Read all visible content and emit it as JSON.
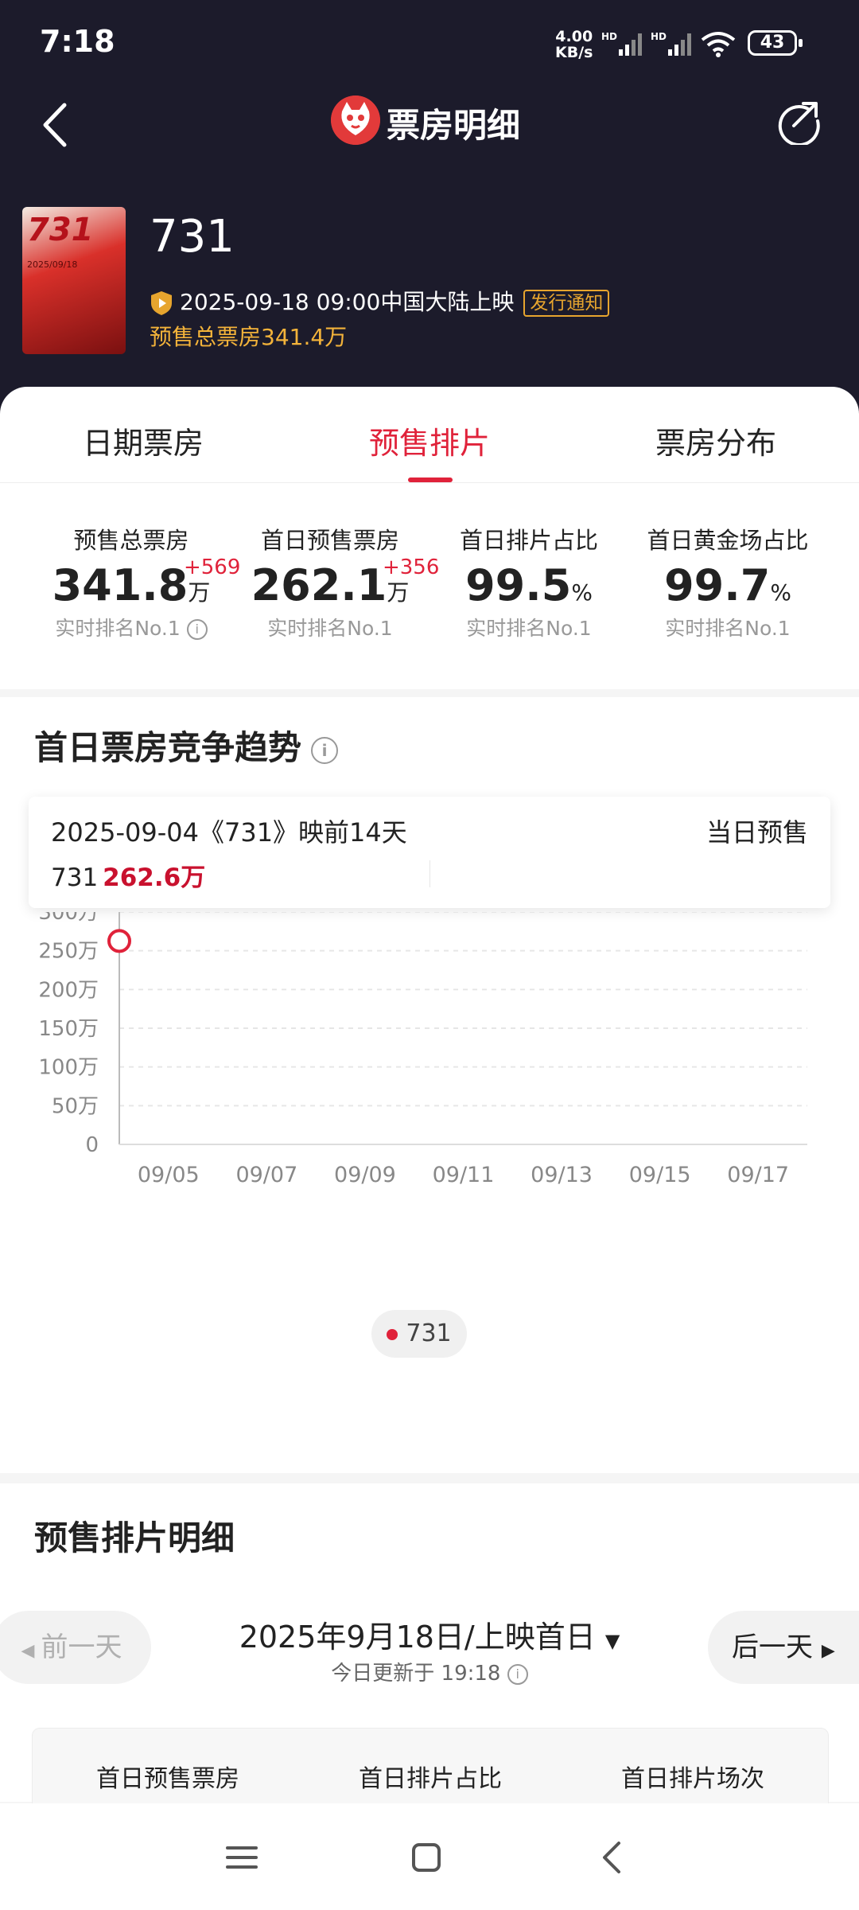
{
  "status_bar": {
    "time": "7:18",
    "speed_value": "4.00",
    "speed_unit": "KB/s",
    "signal_1_label": "HD",
    "signal_2_label": "HD",
    "battery": "43"
  },
  "header": {
    "title": "票房明细"
  },
  "movie": {
    "name": "731",
    "release_text": "2025-09-18 09:00中国大陆上映",
    "release_badge": "发行通知",
    "presale_total": "预售总票房341.4万",
    "poster_title": "731",
    "poster_date": "2025/09/18"
  },
  "tabs": [
    {
      "label": "日期票房",
      "active": false
    },
    {
      "label": "预售排片",
      "active": true
    },
    {
      "label": "票房分布",
      "active": false
    }
  ],
  "stats": [
    {
      "label": "预售总票房",
      "value": "341.8",
      "unit": "万",
      "delta": "+569",
      "rank": "实时排名No.1"
    },
    {
      "label": "首日预售票房",
      "value": "262.1",
      "unit": "万",
      "delta": "+356",
      "rank": "实时排名No.1"
    },
    {
      "label": "首日排片占比",
      "value": "99.5",
      "unit": "%",
      "delta": "",
      "rank": "实时排名No.1"
    },
    {
      "label": "首日黄金场占比",
      "value": "99.7",
      "unit": "%",
      "delta": "",
      "rank": "实时排名No.1"
    }
  ],
  "trend": {
    "title": "首日票房竞争趋势",
    "tooltip": {
      "date_text": "2025-09-04《731》映前14天",
      "kind": "当日预售",
      "series_name": "731",
      "value": "262.6万"
    },
    "legend": "731"
  },
  "chart_data": {
    "type": "line",
    "x": [
      "09/05",
      "09/07",
      "09/09",
      "09/11",
      "09/13",
      "09/15",
      "09/17"
    ],
    "y_ticks": [
      "0",
      "50万",
      "100万",
      "150万",
      "200万",
      "250万",
      "300万"
    ],
    "ylim": [
      0,
      300
    ],
    "grid": true,
    "legend_placement": "bottom-center",
    "series": [
      {
        "name": "731",
        "color": "#e0223a",
        "points": [
          {
            "x": "09/04",
            "y": 262.6
          }
        ]
      }
    ]
  },
  "detail": {
    "title": "预售排片明细",
    "prev_day": "前一天",
    "next_day": "后一天",
    "date_label": "2025年9月18日/上映首日",
    "updated": "今日更新于 19:18",
    "columns": [
      "首日预售票房",
      "首日排片占比",
      "首日排片场次"
    ]
  },
  "colors": {
    "accent": "#e0223a",
    "header_bg": "#1c1b2b",
    "gold": "#f3b33a"
  }
}
